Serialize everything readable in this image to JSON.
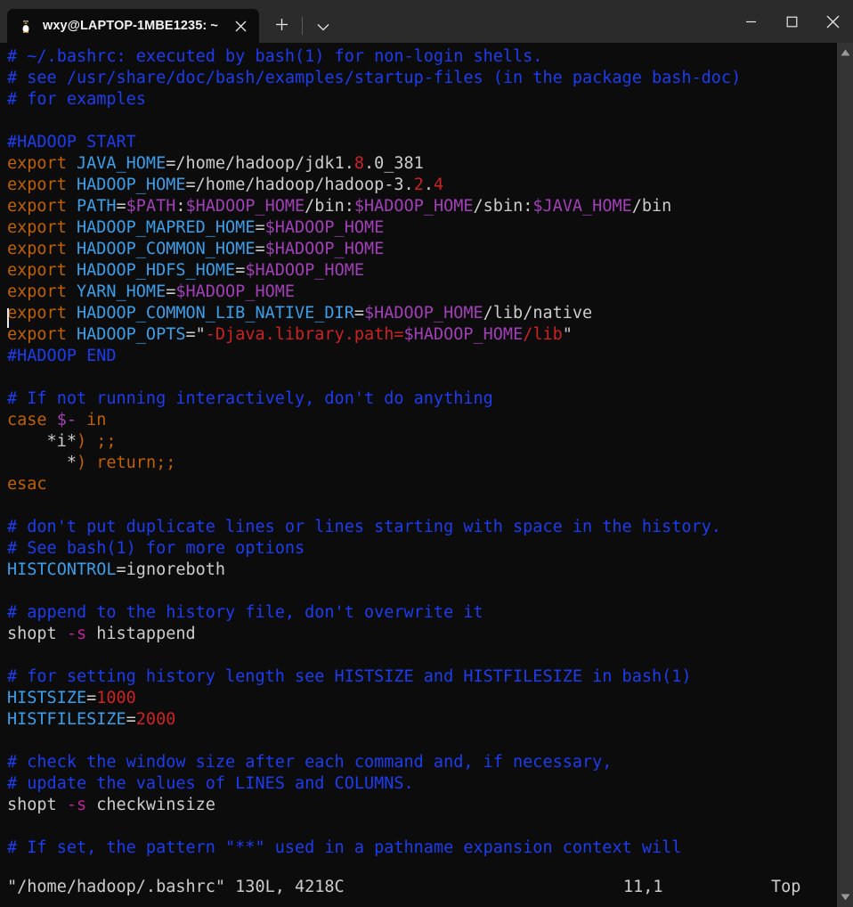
{
  "window": {
    "tab": {
      "title": "wxy@LAPTOP-1MBE1235: ~",
      "icon": "tux-penguin-icon",
      "close_label": "✕"
    },
    "new_tab_label": "+",
    "dropdown_label": "⌄",
    "controls": {
      "minimize": "–",
      "maximize": "□",
      "close": "✕"
    },
    "colors": {
      "titlebar_bg": "#2b2b2b",
      "terminal_bg": "#0c0c0c",
      "foreground": "#cccccc",
      "comment": "#1c3cf0",
      "keyword": "#c06000",
      "identifier": "#3b9eea",
      "variable": "#a23fb8",
      "number": "#cc2222",
      "string": "#cc2222",
      "flag": "#c0209c",
      "scrollbar": "#333333"
    }
  },
  "editor": {
    "app": "vim",
    "lines": [
      [
        {
          "t": "# ~/.bashrc: executed by bash(1) for non-login shells.",
          "c": "c-comment"
        }
      ],
      [
        {
          "t": "# see /usr/share/doc/bash/examples/startup-files (in the package bash-doc)",
          "c": "c-comment"
        }
      ],
      [
        {
          "t": "# for examples",
          "c": "c-comment"
        }
      ],
      [
        {
          "t": "",
          "c": "c-plain"
        }
      ],
      [
        {
          "t": "#HADOOP START",
          "c": "c-comment"
        }
      ],
      [
        {
          "t": "export",
          "c": "c-keyword"
        },
        {
          "t": " ",
          "c": "c-plain"
        },
        {
          "t": "JAVA_HOME",
          "c": "c-ident"
        },
        {
          "t": "=/home/hadoop/jdk1.",
          "c": "c-plain"
        },
        {
          "t": "8",
          "c": "c-num"
        },
        {
          "t": ".0_381",
          "c": "c-plain"
        }
      ],
      [
        {
          "t": "export",
          "c": "c-keyword"
        },
        {
          "t": " ",
          "c": "c-plain"
        },
        {
          "t": "HADOOP_HOME",
          "c": "c-ident"
        },
        {
          "t": "=/home/hadoop/hadoop-3.",
          "c": "c-plain"
        },
        {
          "t": "2",
          "c": "c-num"
        },
        {
          "t": ".",
          "c": "c-plain"
        },
        {
          "t": "4",
          "c": "c-num"
        }
      ],
      [
        {
          "t": "export",
          "c": "c-keyword"
        },
        {
          "t": " ",
          "c": "c-plain"
        },
        {
          "t": "PATH",
          "c": "c-ident"
        },
        {
          "t": "=",
          "c": "c-plain"
        },
        {
          "t": "$PATH",
          "c": "c-var"
        },
        {
          "t": ":",
          "c": "c-plain"
        },
        {
          "t": "$HADOOP_HOME",
          "c": "c-var"
        },
        {
          "t": "/bin:",
          "c": "c-plain"
        },
        {
          "t": "$HADOOP_HOME",
          "c": "c-var"
        },
        {
          "t": "/sbin:",
          "c": "c-plain"
        },
        {
          "t": "$JAVA_HOME",
          "c": "c-var"
        },
        {
          "t": "/bin",
          "c": "c-plain"
        }
      ],
      [
        {
          "t": "export",
          "c": "c-keyword"
        },
        {
          "t": " ",
          "c": "c-plain"
        },
        {
          "t": "HADOOP_MAPRED_HOME",
          "c": "c-ident"
        },
        {
          "t": "=",
          "c": "c-plain"
        },
        {
          "t": "$HADOOP_HOME",
          "c": "c-var"
        }
      ],
      [
        {
          "t": "export",
          "c": "c-keyword"
        },
        {
          "t": " ",
          "c": "c-plain"
        },
        {
          "t": "HADOOP_COMMON_HOME",
          "c": "c-ident"
        },
        {
          "t": "=",
          "c": "c-plain"
        },
        {
          "t": "$HADOOP_HOME",
          "c": "c-var"
        }
      ],
      [
        {
          "t": "export",
          "c": "c-keyword"
        },
        {
          "t": " ",
          "c": "c-plain"
        },
        {
          "t": "HADOOP_HDFS_HOME",
          "c": "c-ident"
        },
        {
          "t": "=",
          "c": "c-plain"
        },
        {
          "t": "$HADOOP_HOME",
          "c": "c-var"
        }
      ],
      [
        {
          "t": "export",
          "c": "c-keyword"
        },
        {
          "t": " ",
          "c": "c-plain"
        },
        {
          "t": "YARN_HOME",
          "c": "c-ident"
        },
        {
          "t": "=",
          "c": "c-plain"
        },
        {
          "t": "$HADOOP_HOME",
          "c": "c-var"
        }
      ],
      [
        {
          "t": "export",
          "c": "c-keyword"
        },
        {
          "t": " ",
          "c": "c-plain"
        },
        {
          "t": "HADOOP_COMMON_LIB_NATIVE_DIR",
          "c": "c-ident"
        },
        {
          "t": "=",
          "c": "c-plain"
        },
        {
          "t": "$HADOOP_HOME",
          "c": "c-var"
        },
        {
          "t": "/lib/native",
          "c": "c-plain"
        }
      ],
      [
        {
          "t": "export",
          "c": "c-keyword"
        },
        {
          "t": " ",
          "c": "c-plain"
        },
        {
          "t": "HADOOP_OPTS",
          "c": "c-ident"
        },
        {
          "t": "=",
          "c": "c-plain"
        },
        {
          "t": "\"",
          "c": "c-plain"
        },
        {
          "t": "-Djava.library.path=",
          "c": "c-str"
        },
        {
          "t": "$HADOOP_HOME",
          "c": "c-var"
        },
        {
          "t": "/lib",
          "c": "c-str"
        },
        {
          "t": "\"",
          "c": "c-plain"
        }
      ],
      [
        {
          "t": "#HADOOP END",
          "c": "c-comment"
        }
      ],
      [
        {
          "t": "",
          "c": "c-plain"
        }
      ],
      [
        {
          "t": "# If not running interactively, don't do anything",
          "c": "c-comment"
        }
      ],
      [
        {
          "t": "case",
          "c": "c-keyword"
        },
        {
          "t": " ",
          "c": "c-plain"
        },
        {
          "t": "$-",
          "c": "c-var"
        },
        {
          "t": " ",
          "c": "c-plain"
        },
        {
          "t": "in",
          "c": "c-keyword"
        }
      ],
      [
        {
          "t": "    *i*",
          "c": "c-plain"
        },
        {
          "t": ")",
          "c": "c-keyword"
        },
        {
          "t": " ",
          "c": "c-plain"
        },
        {
          "t": ";;",
          "c": "c-keyword"
        }
      ],
      [
        {
          "t": "      *",
          "c": "c-plain"
        },
        {
          "t": ")",
          "c": "c-keyword"
        },
        {
          "t": " ",
          "c": "c-plain"
        },
        {
          "t": "return",
          "c": "c-keyword"
        },
        {
          "t": ";;",
          "c": "c-keyword"
        }
      ],
      [
        {
          "t": "esac",
          "c": "c-keyword"
        }
      ],
      [
        {
          "t": "",
          "c": "c-plain"
        }
      ],
      [
        {
          "t": "# don't put duplicate lines or lines starting with space in the history.",
          "c": "c-comment"
        }
      ],
      [
        {
          "t": "# See bash(1) for more options",
          "c": "c-comment"
        }
      ],
      [
        {
          "t": "HISTCONTROL",
          "c": "c-ident"
        },
        {
          "t": "=ignoreboth",
          "c": "c-plain"
        }
      ],
      [
        {
          "t": "",
          "c": "c-plain"
        }
      ],
      [
        {
          "t": "# append to the history file, don't overwrite it",
          "c": "c-comment"
        }
      ],
      [
        {
          "t": "shopt ",
          "c": "c-plain"
        },
        {
          "t": "-s",
          "c": "c-flag"
        },
        {
          "t": " histappend",
          "c": "c-plain"
        }
      ],
      [
        {
          "t": "",
          "c": "c-plain"
        }
      ],
      [
        {
          "t": "# for setting history length see HISTSIZE and HISTFILESIZE in bash(1)",
          "c": "c-comment"
        }
      ],
      [
        {
          "t": "HISTSIZE",
          "c": "c-ident"
        },
        {
          "t": "=",
          "c": "c-plain"
        },
        {
          "t": "1000",
          "c": "c-num"
        }
      ],
      [
        {
          "t": "HISTFILESIZE",
          "c": "c-ident"
        },
        {
          "t": "=",
          "c": "c-plain"
        },
        {
          "t": "2000",
          "c": "c-num"
        }
      ],
      [
        {
          "t": "",
          "c": "c-plain"
        }
      ],
      [
        {
          "t": "# check the window size after each command and, if necessary,",
          "c": "c-comment"
        }
      ],
      [
        {
          "t": "# update the values of LINES and COLUMNS.",
          "c": "c-comment"
        }
      ],
      [
        {
          "t": "shopt ",
          "c": "c-plain"
        },
        {
          "t": "-s",
          "c": "c-flag"
        },
        {
          "t": " checkwinsize",
          "c": "c-plain"
        }
      ],
      [
        {
          "t": "",
          "c": "c-plain"
        }
      ],
      [
        {
          "t": "# If set, the pattern \"**\" used in a pathname expansion context will",
          "c": "c-comment"
        }
      ]
    ],
    "cursor": {
      "line_index": 10,
      "column": 1
    },
    "status": {
      "file": "\"/home/hadoop/.bashrc\" 130L, 4218C",
      "position": "11,1",
      "scroll": "Top"
    }
  }
}
